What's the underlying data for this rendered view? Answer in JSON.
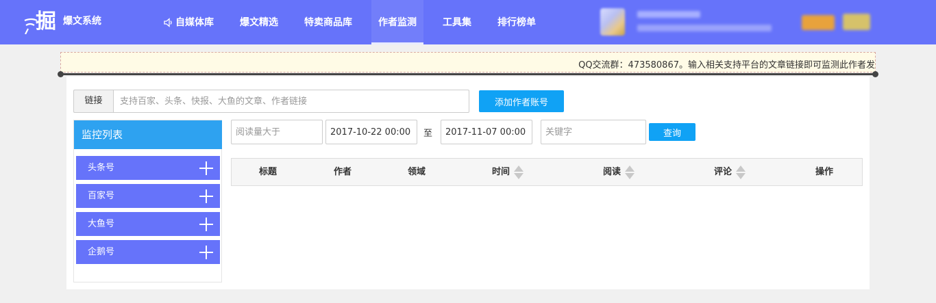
{
  "header": {
    "brand_name": "爆文系统",
    "logo_char": "掘",
    "nav": [
      {
        "label": "自媒体库",
        "icon": "speaker-icon"
      },
      {
        "label": "爆文精选"
      },
      {
        "label": "特卖商品库"
      },
      {
        "label": "作者监测",
        "active": true
      },
      {
        "label": "工具集"
      },
      {
        "label": "排行榜单"
      }
    ],
    "accent_color": "#6673fa"
  },
  "notice": {
    "text": "QQ交流群：473580867。输入相关支持平台的文章链接即可监测此作者发"
  },
  "link_form": {
    "label": "链接",
    "placeholder": "支持百家、头条、快报、大鱼的文章、作者链接",
    "add_button": "添加作者账号"
  },
  "sidebar": {
    "title": "监控列表",
    "items": [
      "头条号",
      "百家号",
      "大鱼号",
      "企鹅号"
    ]
  },
  "filters": {
    "reads_placeholder": "阅读量大于",
    "start_date": "2017-10-22 00:00",
    "to_label": "至",
    "end_date": "2017-11-07 00:00",
    "keyword_placeholder": "关键字",
    "query_button": "查询"
  },
  "table": {
    "columns": [
      "标题",
      "作者",
      "领域",
      "时间",
      "阅读",
      "评论",
      "操作"
    ]
  }
}
